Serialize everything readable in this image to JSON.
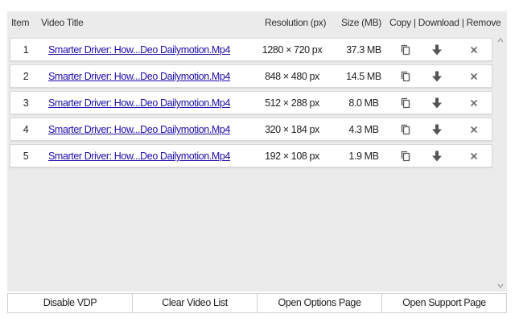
{
  "header": {
    "item": "Item",
    "title": "Video Title",
    "resolution": "Resolution (px)",
    "size": "Size (MB)",
    "actions": "Copy | Download | Remove"
  },
  "icons": {
    "copy": "copy-icon",
    "download": "download-arrow-icon",
    "remove": "close-icon",
    "scroll_up": "chevron-up-icon",
    "scroll_down": "chevron-down-icon"
  },
  "colors": {
    "link": "#1a0dab",
    "panel": "#ebebeb",
    "icon": "#555555"
  },
  "rows": [
    {
      "item": "1",
      "title": "Smarter Driver: How...Deo Dailymotion.Mp4",
      "resolution": "1280 × 720 px",
      "size": "37.3 MB"
    },
    {
      "item": "2",
      "title": "Smarter Driver: How...Deo Dailymotion.Mp4",
      "resolution": "848 × 480 px",
      "size": "14.5 MB"
    },
    {
      "item": "3",
      "title": "Smarter Driver: How...Deo Dailymotion.Mp4",
      "resolution": "512 × 288 px",
      "size": "8.0 MB"
    },
    {
      "item": "4",
      "title": "Smarter Driver: How...Deo Dailymotion.Mp4",
      "resolution": "320 × 184 px",
      "size": "4.3 MB"
    },
    {
      "item": "5",
      "title": "Smarter Driver: How...Deo Dailymotion.Mp4",
      "resolution": "192 × 108 px",
      "size": "1.9 MB"
    }
  ],
  "footer": {
    "disable_vdp": "Disable VDP",
    "clear_list": "Clear Video List",
    "open_options": "Open Options Page",
    "open_support": "Open Support Page"
  }
}
